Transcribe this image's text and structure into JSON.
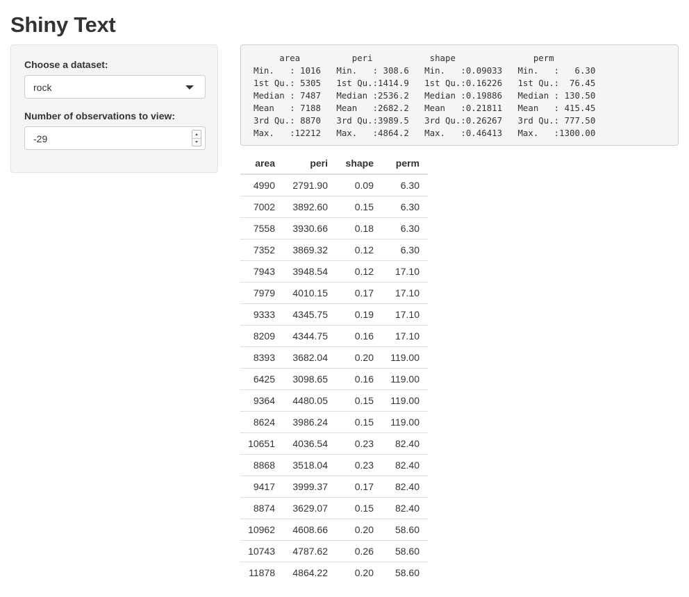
{
  "page": {
    "title": "Shiny Text"
  },
  "sidebar": {
    "dataset_label": "Choose a dataset:",
    "dataset_value": "rock",
    "obs_label": "Number of observations to view:",
    "obs_value": "-29"
  },
  "summary": {
    "lines": [
      "     area          peri           shape               perm",
      "Min.   : 1016   Min.   : 308.6   Min.   :0.09033   Min.   :   6.30",
      "1st Qu.: 5305   1st Qu.:1414.9   1st Qu.:0.16226   1st Qu.:  76.45",
      "Median : 7487   Median :2536.2   Median :0.19886   Median : 130.50",
      "Mean   : 7188   Mean   :2682.2   Mean   :0.21811   Mean   : 415.45",
      "3rd Qu.: 8870   3rd Qu.:3989.5   3rd Qu.:0.26267   3rd Qu.: 777.50",
      "Max.   :12212   Max.   :4864.2   Max.   :0.46413   Max.   :1300.00"
    ]
  },
  "table": {
    "columns": [
      "area",
      "peri",
      "shape",
      "perm"
    ],
    "rows": [
      [
        "4990",
        "2791.90",
        "0.09",
        "6.30"
      ],
      [
        "7002",
        "3892.60",
        "0.15",
        "6.30"
      ],
      [
        "7558",
        "3930.66",
        "0.18",
        "6.30"
      ],
      [
        "7352",
        "3869.32",
        "0.12",
        "6.30"
      ],
      [
        "7943",
        "3948.54",
        "0.12",
        "17.10"
      ],
      [
        "7979",
        "4010.15",
        "0.17",
        "17.10"
      ],
      [
        "9333",
        "4345.75",
        "0.19",
        "17.10"
      ],
      [
        "8209",
        "4344.75",
        "0.16",
        "17.10"
      ],
      [
        "8393",
        "3682.04",
        "0.20",
        "119.00"
      ],
      [
        "6425",
        "3098.65",
        "0.16",
        "119.00"
      ],
      [
        "9364",
        "4480.05",
        "0.15",
        "119.00"
      ],
      [
        "8624",
        "3986.24",
        "0.15",
        "119.00"
      ],
      [
        "10651",
        "4036.54",
        "0.23",
        "82.40"
      ],
      [
        "8868",
        "3518.04",
        "0.23",
        "82.40"
      ],
      [
        "9417",
        "3999.37",
        "0.17",
        "82.40"
      ],
      [
        "8874",
        "3629.07",
        "0.15",
        "82.40"
      ],
      [
        "10962",
        "4608.66",
        "0.20",
        "58.60"
      ],
      [
        "10743",
        "4787.62",
        "0.26",
        "58.60"
      ],
      [
        "11878",
        "4864.22",
        "0.20",
        "58.60"
      ]
    ]
  }
}
